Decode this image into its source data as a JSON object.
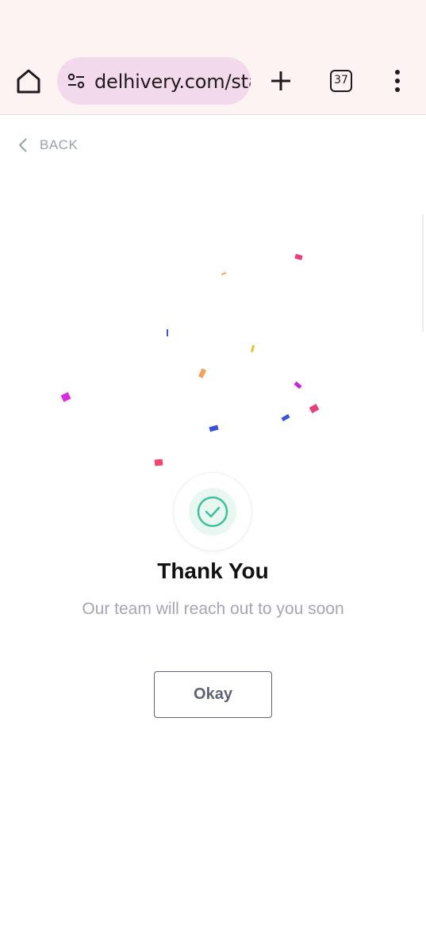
{
  "browser": {
    "url": "delhivery.com/start",
    "tab_count": "37"
  },
  "page": {
    "back_label": "BACK",
    "title": "Thank You",
    "subtitle": "Our team will reach out to you soon",
    "okay_label": "Okay"
  },
  "colors": {
    "browser_bar": "#fdf3f3",
    "url_pill": "#f3d9ec",
    "success_green": "#3fbf9b",
    "muted_text": "#a3a7b3",
    "button_border": "#5d6275"
  },
  "icons": [
    "home-icon",
    "site-settings-icon",
    "plus-icon",
    "tab-switcher-icon",
    "more-vert-icon",
    "chevron-left-icon",
    "check-circle-icon"
  ]
}
